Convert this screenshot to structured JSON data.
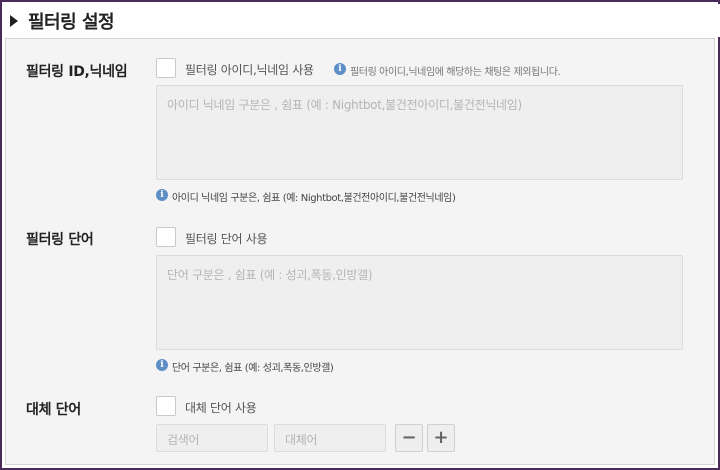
{
  "header": {
    "title": "필터링 설정"
  },
  "sections": {
    "id_filter": {
      "label": "필터링 ID,닉네임",
      "checkbox_label": "필터링 아이디,닉네임 사용",
      "inline_info": "필터링 아이디,닉네임에 해당하는 채팅은 제외됩니다.",
      "placeholder": "아이디 닉네임 구분은 , 쉼표 (예 : Nightbot,불건전아이디,불건전닉네임)",
      "help": "아이디 닉네임 구분은, 쉼표 (예: Nightbot,불건전아이디,불건전닉네임)"
    },
    "word_filter": {
      "label": "필터링 단어",
      "checkbox_label": "필터링 단어 사용",
      "placeholder": "단어 구분은 , 쉼표 (예 : 성괴,폭동,인방갤)",
      "help": "단어 구분은, 쉼표 (예: 성괴,폭동,인방갤)"
    },
    "replace": {
      "label": "대체 단어",
      "checkbox_label": "대체 단어 사용",
      "search_placeholder": "검색어",
      "replace_placeholder": "대체어",
      "minus_label": "−",
      "plus_label": "+"
    }
  },
  "icons": {
    "info": "info-icon",
    "section_marker": "triangle-right-icon"
  },
  "colors": {
    "frame": "#4a2a5a",
    "info_blue": "#5f8fc7",
    "panel_bg": "#f4f4f4"
  }
}
